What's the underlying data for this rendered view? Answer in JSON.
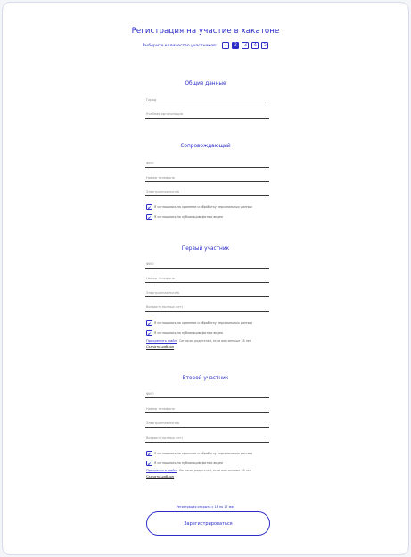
{
  "page": {
    "title": "Регистрация на участие в хакатоне",
    "count_label": "Выберите количество участников:",
    "count_options": [
      "1",
      "2",
      "3",
      "4",
      "5"
    ],
    "selected_count": "2"
  },
  "general": {
    "title": "Общие данные",
    "fields": [
      "Город",
      "Учебная организация"
    ]
  },
  "companion": {
    "title": "Сопровождающий",
    "fields": [
      "ФИО",
      "Номер телефона",
      "Электронная почта"
    ],
    "checks": [
      "Я соглашаюсь на хранение и обработку персональных данных",
      "Я соглашаюсь на публикацию фото и видео"
    ]
  },
  "participant1": {
    "title": "Первый участник",
    "fields": [
      "ФИО",
      "Номер телефона",
      "Электронная почта",
      "Возраст (полных лет)"
    ],
    "checks": [
      "Я соглашаюсь на хранение и обработку персональных данных",
      "Я соглашаюсь на публикацию фото и видео"
    ],
    "attach_label": "Прикрепить файл",
    "attach_note": "Согласие родителей, если вам меньше 18 лет",
    "download_label": "Скачать шаблон"
  },
  "participant2": {
    "title": "Второй участник",
    "fields": [
      "ФИО",
      "Номер телефона",
      "Электронная почта",
      "Возраст (полных лет)"
    ],
    "checks": [
      "Я соглашаюсь на хранение и обработку персональных данных",
      "Я соглашаюсь на публикацию фото и видео"
    ],
    "attach_label": "Прикрепить файл",
    "attach_note": "Согласие родителей, если вам меньше 18 лет",
    "download_label": "Скачать шаблон"
  },
  "footer": {
    "deadline": "Регистрация открыта с 18 по 17 мая",
    "submit_label": "Зарегистрироваться"
  },
  "colors": {
    "accent": "#2c2cc8",
    "frame_border": "#d7dbe9",
    "background": "#f4f5f8"
  }
}
